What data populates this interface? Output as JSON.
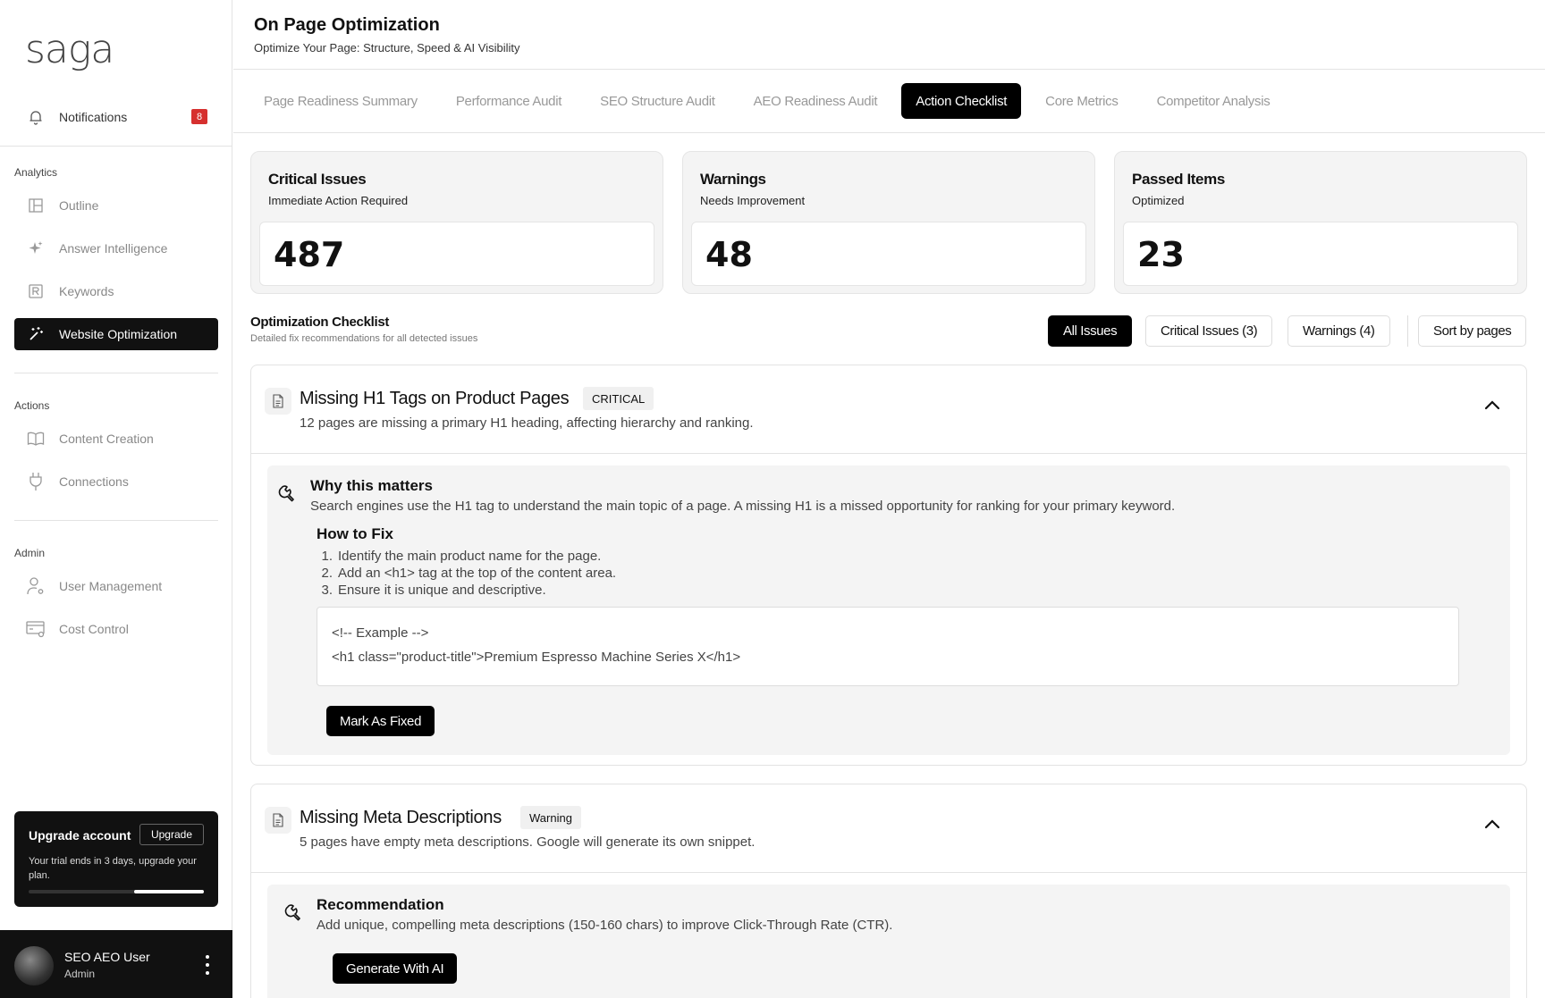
{
  "sidebar": {
    "logo": "saga",
    "notifications": {
      "label": "Notifications",
      "count": "8"
    },
    "sections": {
      "analytics": "Analytics",
      "actions": "Actions",
      "admin": "Admin"
    },
    "items": {
      "outline": "Outline",
      "answer_intelligence": "Answer Intelligence",
      "keywords": "Keywords",
      "website_optimization": "Website Optimization",
      "content_creation": "Content Creation",
      "connections": "Connections",
      "user_management": "User Management",
      "cost_control": "Cost Control"
    },
    "upgrade": {
      "title": "Upgrade account",
      "button": "Upgrade",
      "description": "Your trial ends in 3 days, upgrade your plan.",
      "progress": 0.4
    },
    "user": {
      "name": "SEO AEO User",
      "role": "Admin"
    }
  },
  "header": {
    "title": "On Page Optimization",
    "subtitle": "Optimize Your Page: Structure, Speed & AI Visibility"
  },
  "tabs": [
    "Page Readiness Summary",
    "Performance Audit",
    "SEO Structure Audit",
    "AEO Readiness Audit",
    "Action Checklist",
    "Core Metrics",
    "Competitor Analysis"
  ],
  "active_tab": "Action Checklist",
  "stats": {
    "critical": {
      "title": "Critical Issues",
      "subtitle": "Immediate Action Required",
      "value": "487"
    },
    "warnings": {
      "title": "Warnings",
      "subtitle": "Needs Improvement",
      "value": "48"
    },
    "passed": {
      "title": "Passed Items",
      "subtitle": "Optimized",
      "value": "23"
    }
  },
  "checklist": {
    "title": "Optimization Checklist",
    "subtitle": "Detailed fix recommendations for all detected issues",
    "filters": {
      "all": "All Issues",
      "critical": "Critical Issues (3)",
      "warnings": "Warnings (4)",
      "sort": "Sort by pages"
    }
  },
  "issues": [
    {
      "title": "Missing H1 Tags on Product Pages",
      "tag": "CRITICAL",
      "description": "12 pages are missing a primary H1 heading, affecting hierarchy and ranking.",
      "why_title": "Why this matters",
      "why_text": "Search engines use the H1 tag to understand the main topic of a page. A missing H1 is a missed opportunity for ranking for your primary keyword.",
      "howto_title": "How to Fix",
      "steps": [
        "Identify the main product name for the page.",
        "Add an <h1> tag at the top of the content area.",
        "Ensure it is unique and descriptive."
      ],
      "code": [
        "<!-- Example -->",
        "<h1 class=\"product-title\">Premium Espresso Machine Series X</h1>"
      ],
      "action": "Mark As Fixed"
    },
    {
      "title": "Missing Meta Descriptions",
      "tag": "Warning",
      "description": "5 pages have empty meta descriptions. Google will generate its own snippet.",
      "rec_title": "Recommendation",
      "rec_text": "Add unique, compelling meta descriptions (150-160 chars) to improve Click-Through Rate (CTR).",
      "action": "Generate With AI"
    }
  ]
}
